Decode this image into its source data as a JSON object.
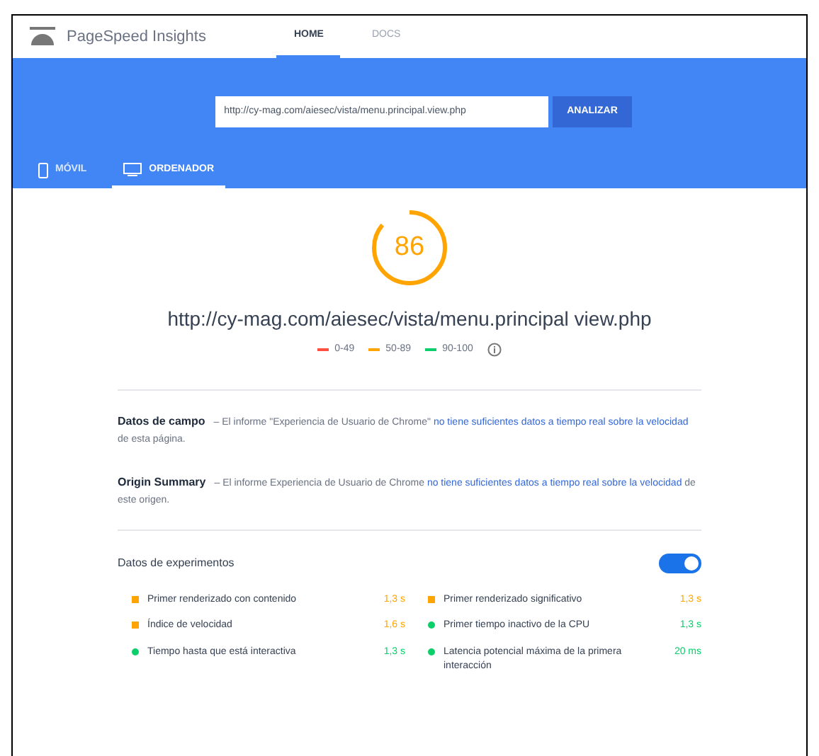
{
  "header": {
    "title": "PageSpeed Insights",
    "nav": [
      {
        "label": "HOME",
        "selected": true
      },
      {
        "label": "DOCS",
        "selected": false
      }
    ]
  },
  "search": {
    "value": "http://cy-mag.com/aiesec/vista/menu.principal.view.php",
    "button": "ANALIZAR"
  },
  "device_tabs": [
    {
      "label": "MÓVIL",
      "kind": "phone",
      "selected": false
    },
    {
      "label": "ORDENADOR",
      "kind": "desktop",
      "selected": true
    }
  ],
  "score": {
    "value": "86",
    "level": 0.86,
    "color": "#ffa400",
    "url": "http://cy-mag.com/aiesec/vista/menu.principal view.php"
  },
  "legend": [
    {
      "label": "0-49",
      "color": "#ff4e42"
    },
    {
      "label": "50-89",
      "color": "#ffa400"
    },
    {
      "label": "90-100",
      "color": "#0cce6b"
    }
  ],
  "sections": [
    {
      "title": "Datos de campo",
      "text": "– El informe \"Experiencia de Usuario de Chrome\" ",
      "link": "no tiene suficientes datos a tiempo real sobre la velocidad",
      "rest": " de esta página."
    },
    {
      "title": "Origin Summary",
      "text": "– El informe Experiencia de Usuario de Chrome ",
      "link": "no tiene suficientes datos a tiempo real sobre la velocidad",
      "rest": " de este origen."
    }
  ],
  "lab": {
    "title": "Datos de experimentos",
    "toggle_on": true,
    "metrics": [
      {
        "name": "Primer renderizado con contenido",
        "value": "1,3 s",
        "color": "#ffa400",
        "kind": "square"
      },
      {
        "name": "Primer renderizado significativo",
        "value": "1,3 s",
        "color": "#ffa400",
        "kind": "square"
      },
      {
        "name": "Índice de velocidad",
        "value": "1,6 s",
        "color": "#ffa400",
        "kind": "square"
      },
      {
        "name": "Primer tiempo inactivo de la CPU",
        "value": "1,3 s",
        "color": "#0cce6b",
        "kind": "circle"
      },
      {
        "name": "Tiempo hasta que está interactiva",
        "value": "1,3 s",
        "color": "#0cce6b",
        "kind": "circle"
      },
      {
        "name": "Latencia potencial máxima de la primera interacción",
        "value": "20 ms",
        "color": "#0cce6b",
        "kind": "circle"
      }
    ]
  }
}
